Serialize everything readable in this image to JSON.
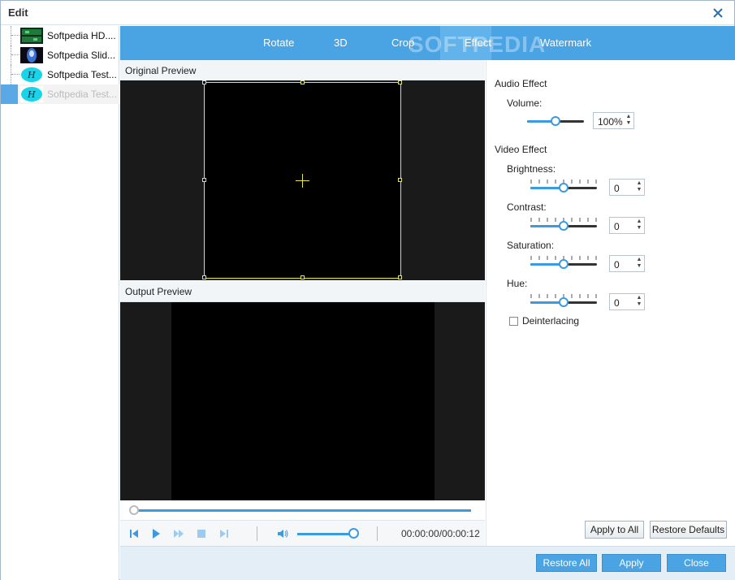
{
  "window": {
    "title": "Edit"
  },
  "files": [
    {
      "name": "Softpedia HD....",
      "thumb": "green-film-thumb"
    },
    {
      "name": "Softpedia Slid...",
      "thumb": "blue-figure-thumb"
    },
    {
      "name": "Softpedia Test...",
      "thumb": "cyan-logo-thumb"
    },
    {
      "name": "Softpedia Test...",
      "thumb": "cyan-logo-thumb",
      "selected": true
    }
  ],
  "tabs": [
    {
      "label": "Rotate"
    },
    {
      "label": "3D"
    },
    {
      "label": "Crop"
    },
    {
      "label": "Effect",
      "active": true
    },
    {
      "label": "Watermark"
    }
  ],
  "watermark_text": "SOFTPEDIA",
  "preview": {
    "original_label": "Original Preview",
    "output_label": "Output Preview"
  },
  "playback": {
    "timecode": "00:00:00/00:00:12",
    "volume_level": 0.9,
    "seek_position": 0.0
  },
  "audio": {
    "section_label": "Audio Effect",
    "volume_label": "Volume:",
    "volume_value": "100%",
    "volume_level": 0.5
  },
  "video": {
    "section_label": "Video Effect",
    "brightness_label": "Brightness:",
    "brightness_value": "0",
    "contrast_label": "Contrast:",
    "contrast_value": "0",
    "saturation_label": "Saturation:",
    "saturation_value": "0",
    "hue_label": "Hue:",
    "hue_value": "0",
    "slider_level": 0.5,
    "deinterlacing_label": "Deinterlacing",
    "deinterlacing_checked": false
  },
  "buttons": {
    "apply_to_all": "Apply to All",
    "restore_defaults": "Restore Defaults",
    "restore_all": "Restore All",
    "apply": "Apply",
    "close": "Close"
  },
  "colors": {
    "accent": "#4aa3e3",
    "crop_frame": "#e6e64a"
  }
}
